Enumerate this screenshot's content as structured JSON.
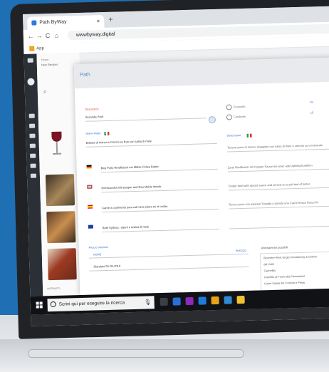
{
  "browser": {
    "tab_title": "Path ByWay",
    "tab_close": "×",
    "new_tab": "+",
    "nav": {
      "back": "←",
      "forward": "→",
      "reload": "C",
      "home": "⌂"
    },
    "url": "wwwbyway.digital",
    "bookmark_label": "App"
  },
  "left_pane": {
    "crumb_1": "Home",
    "crumb_2": "New Recipes",
    "search_icon": "⌕",
    "caption": "ANTIPASTI ·"
  },
  "modal": {
    "title": "Path",
    "field_label_red": "Description",
    "field_value": "Seconda Path",
    "radio_1": "Crossette",
    "radio_2": "Cardinale",
    "desc_label": "Nome Piatto",
    "desc_text": "Battuta di manzo e Porcini su Bun con salsa di mele",
    "translations": [
      {
        "flag": "de",
        "text": "Beg Porto  Rindfleisch mit Mähle Chilea Butter"
      },
      {
        "flag": "uk",
        "text": "Entrecoedel  with pepper and Rau Mahle mmda"
      },
      {
        "flag": "es",
        "text": "Carne a a pimiento para cal mera pitura en el ondas"
      },
      {
        "flag": "eu",
        "text": "Beef Sydney.. daurè e tedina di mele"
      }
    ],
    "right_label": "Descrizione",
    "right_lines": [
      "Tenera carne di manzo maggiore con salsa di mele e semola su un'amarale",
      "Zarte Rindfleisch mit Hopper Sauce bei einer oder Apfelsaft wählen",
      "Tender beef with spiced sauce and served on a soft bed of butter",
      "Tierna carne con espesar Tostado y dorado una Carne fresca fresco fin"
    ],
    "right_top_label": "Ita",
    "right_top_value": "15",
    "pricing_label": "Prezzo Versione",
    "table_col_1": "NOME",
    "table_col_2": "PREZZO",
    "table_row": "Standard 01-05-2019",
    "allergens_label": "Abbinamenti possibili",
    "allergens": [
      "Bicchiere Pinot Grigio Chardonnay & Chenin",
      "del Colle",
      "Cannellini",
      "Capretto al Forno alla Piemontese",
      "Carne Salata del Trentino e Pesto"
    ]
  },
  "taskbar": {
    "search_placeholder": "Scrivi qui per eseguire la ricerca",
    "mic": "🎙"
  }
}
